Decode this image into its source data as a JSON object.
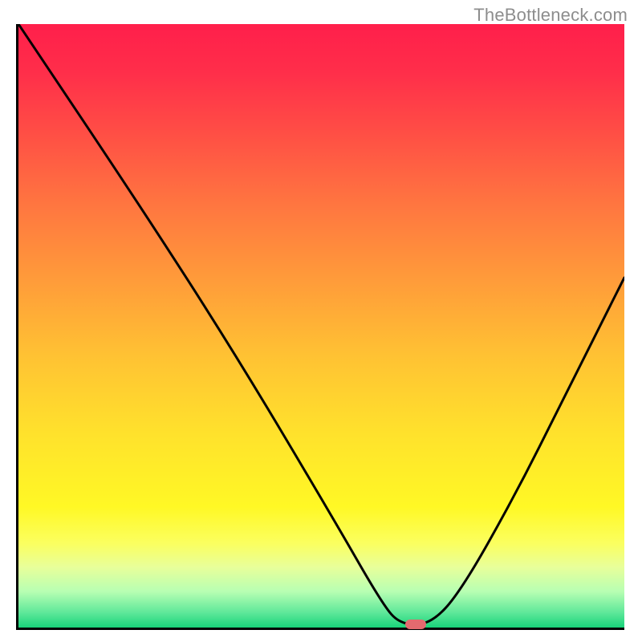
{
  "watermark": "TheBottleneck.com",
  "chart_data": {
    "type": "line",
    "title": "",
    "xlabel": "",
    "ylabel": "",
    "xlim": [
      0,
      100
    ],
    "ylim": [
      0,
      100
    ],
    "grid": false,
    "series": [
      {
        "name": "bottleneck-curve",
        "x_is_fraction_of_width": true,
        "y_is_fraction_of_height_from_top": true,
        "points": [
          {
            "x": 0.0,
            "y": 0.0
          },
          {
            "x": 0.2,
            "y": 0.3
          },
          {
            "x": 0.36,
            "y": 0.55
          },
          {
            "x": 0.52,
            "y": 0.82
          },
          {
            "x": 0.6,
            "y": 0.96
          },
          {
            "x": 0.63,
            "y": 0.995
          },
          {
            "x": 0.68,
            "y": 0.995
          },
          {
            "x": 0.73,
            "y": 0.94
          },
          {
            "x": 0.82,
            "y": 0.78
          },
          {
            "x": 0.9,
            "y": 0.62
          },
          {
            "x": 1.0,
            "y": 0.42
          }
        ]
      }
    ],
    "marker": {
      "name": "optimal-point",
      "x_fraction": 0.655,
      "y_fraction_from_top": 0.995,
      "color": "#e46a6f"
    },
    "background_gradient": {
      "stops": [
        {
          "offset": 0.0,
          "color": "#ff1f4b"
        },
        {
          "offset": 0.08,
          "color": "#ff2e4a"
        },
        {
          "offset": 0.18,
          "color": "#ff4e45"
        },
        {
          "offset": 0.3,
          "color": "#ff7640"
        },
        {
          "offset": 0.42,
          "color": "#ff9a3a"
        },
        {
          "offset": 0.55,
          "color": "#ffc233"
        },
        {
          "offset": 0.68,
          "color": "#ffe22c"
        },
        {
          "offset": 0.8,
          "color": "#fff825"
        },
        {
          "offset": 0.86,
          "color": "#fbff5f"
        },
        {
          "offset": 0.9,
          "color": "#e8ff9a"
        },
        {
          "offset": 0.94,
          "color": "#b8ffb3"
        },
        {
          "offset": 0.975,
          "color": "#5fe89a"
        },
        {
          "offset": 1.0,
          "color": "#19d37a"
        }
      ]
    }
  }
}
